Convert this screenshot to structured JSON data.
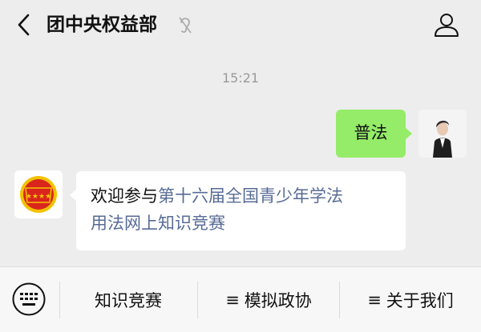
{
  "header": {
    "title": "团中央权益部"
  },
  "chat": {
    "timestamp": "15:21",
    "messages": [
      {
        "sender": "me",
        "text": "普法"
      },
      {
        "sender": "official",
        "text_plain": "欢迎参与",
        "text_link_1": "第十六届全国青少年学法",
        "text_link_2": "用法网上知识竞赛"
      }
    ]
  },
  "menu": {
    "items": [
      {
        "label": "知识竞赛",
        "icon": ""
      },
      {
        "label": "模拟政协",
        "icon": "≡"
      },
      {
        "label": "关于我们",
        "icon": "≡"
      }
    ]
  },
  "icons": [
    "back-arrow-icon",
    "mute-ear-icon",
    "profile-person-icon",
    "keyboard-icon",
    "menu-lines-icon"
  ],
  "colors": {
    "background": "#ededed",
    "my_bubble": "#95ec69",
    "link": "#576b95",
    "league_red": "#d9251d",
    "league_gold": "#f2c200"
  }
}
